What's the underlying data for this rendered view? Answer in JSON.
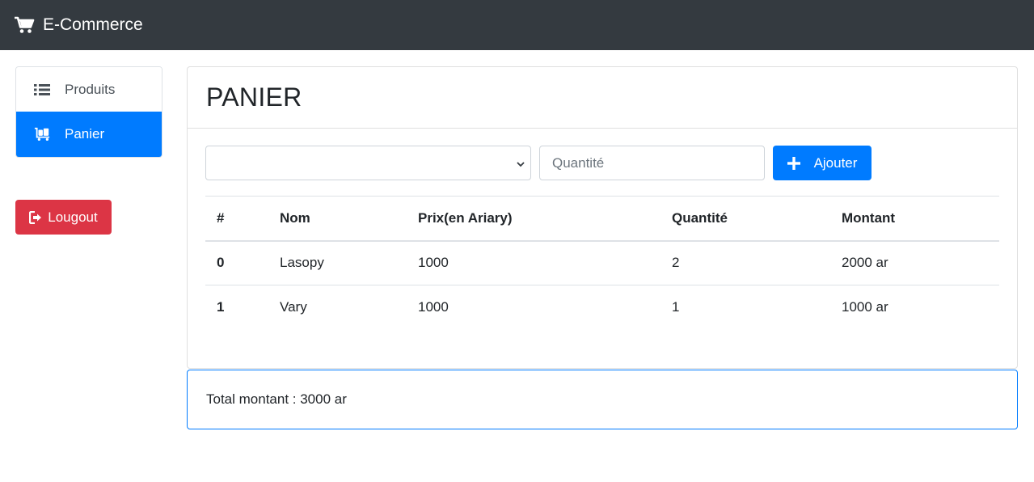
{
  "navbar": {
    "brand": "E-Commerce",
    "brand_icon": "shopping-cart-icon",
    "bg_color": "#343a40"
  },
  "sidebar": {
    "items": [
      {
        "label": "Produits",
        "icon": "list-icon",
        "active": false
      },
      {
        "label": "Panier",
        "icon": "luggage-cart-icon",
        "active": true
      }
    ],
    "logout_label": "Lougout",
    "logout_icon": "sign-out-icon"
  },
  "main": {
    "title": "PANIER",
    "form": {
      "select_value": "",
      "quantity_placeholder": "Quantité",
      "add_label": "Ajouter"
    },
    "table": {
      "headers": [
        "#",
        "Nom",
        "Prix(en Ariary)",
        "Quantité",
        "Montant"
      ],
      "rows": [
        [
          "0",
          "Lasopy",
          "1000",
          "2",
          "2000 ar"
        ],
        [
          "1",
          "Vary",
          "1000",
          "1",
          "1000 ar"
        ]
      ]
    },
    "total": "Total montant : 3000 ar"
  },
  "colors": {
    "primary": "#007bff",
    "danger": "#dc3545",
    "dark": "#343a40"
  }
}
